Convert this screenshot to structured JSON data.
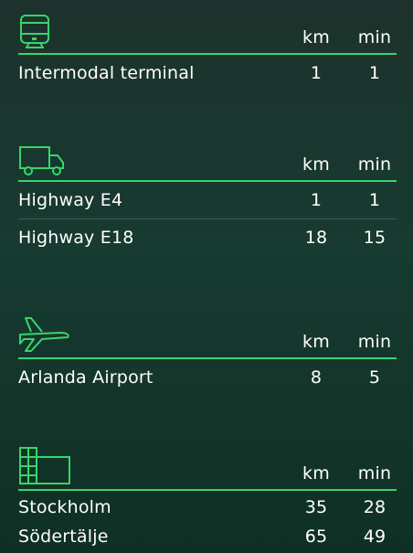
{
  "sections": [
    {
      "icon": "train-icon",
      "header": {
        "km": "km",
        "min": "min"
      },
      "rows": [
        {
          "name": "Intermodal terminal",
          "km": "1",
          "min": "1"
        }
      ]
    },
    {
      "icon": "truck-icon",
      "header": {
        "km": "km",
        "min": "min"
      },
      "rows": [
        {
          "name": "Highway E4",
          "km": "1",
          "min": "1"
        },
        {
          "name": "Highway E18",
          "km": "18",
          "min": "15"
        }
      ]
    },
    {
      "icon": "airplane-icon",
      "header": {
        "km": "km",
        "min": "min"
      },
      "rows": [
        {
          "name": "Arlanda Airport",
          "km": "8",
          "min": "5"
        }
      ]
    },
    {
      "icon": "city-buildings-icon",
      "header": {
        "km": "km",
        "min": "min"
      },
      "rows": [
        {
          "name": "Stockholm",
          "km": "35",
          "min": "28"
        },
        {
          "name": "Södertälje",
          "km": "65",
          "min": "49"
        }
      ]
    }
  ],
  "colors": {
    "accent": "#3ad46b",
    "background_top": "#1d322c",
    "background_bottom": "#0f3024",
    "text": "#ffffff"
  }
}
